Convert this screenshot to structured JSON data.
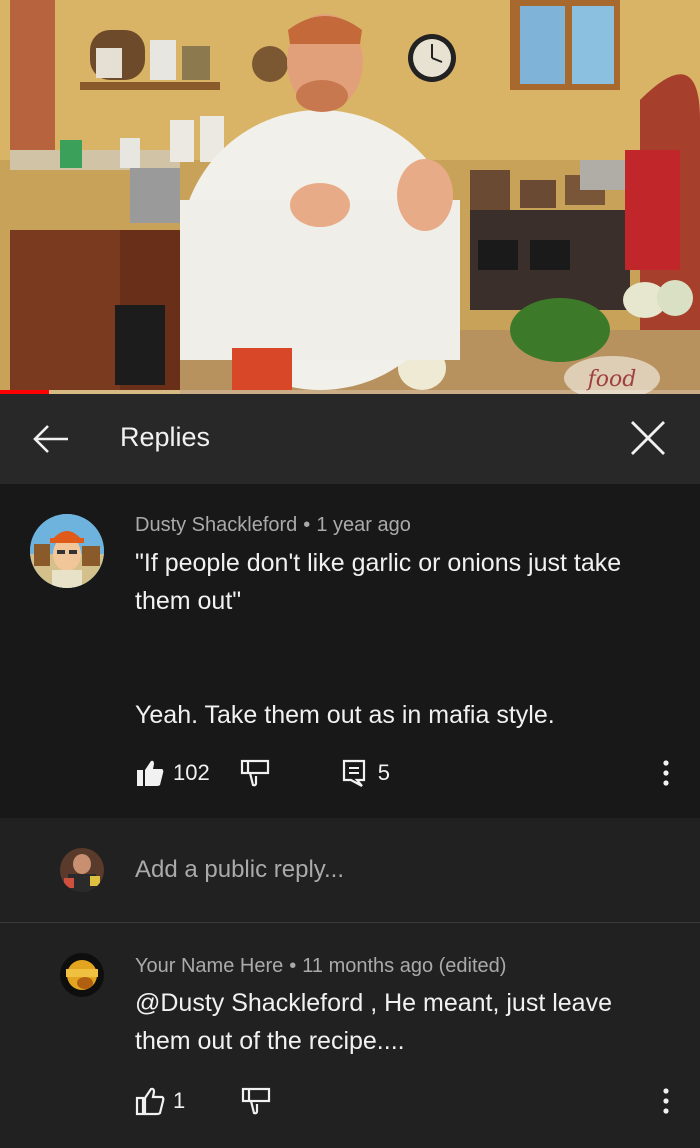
{
  "video": {
    "watermark": "food",
    "progress": 0.07
  },
  "header": {
    "title": "Replies"
  },
  "main_comment": {
    "author": "Dusty Shackleford",
    "separator": "•",
    "time": "1 year ago",
    "text": "\"If people don't like garlic or onions just take them out\"\n\n\nYeah. Take them out as in mafia style.",
    "likes": "102",
    "replies": "5"
  },
  "add_reply": {
    "placeholder": "Add a public reply..."
  },
  "reply": {
    "author": "Your Name Here",
    "separator": "•",
    "time": "11 months ago (edited)",
    "text": "@Dusty Shackleford , He meant,  just leave them out of the recipe....",
    "likes": "1"
  },
  "icons": {
    "back": "arrow-left-icon",
    "close": "close-icon",
    "like": "thumbs-up-icon",
    "dislike": "thumbs-down-icon",
    "reply": "comment-icon",
    "more": "more-vertical-icon"
  },
  "colors": {
    "background": "#212121",
    "header": "#282828",
    "highlight": "#181818",
    "text": "#f1f1f1",
    "secondary": "#aaaaaa",
    "accent": "#ff0000"
  }
}
